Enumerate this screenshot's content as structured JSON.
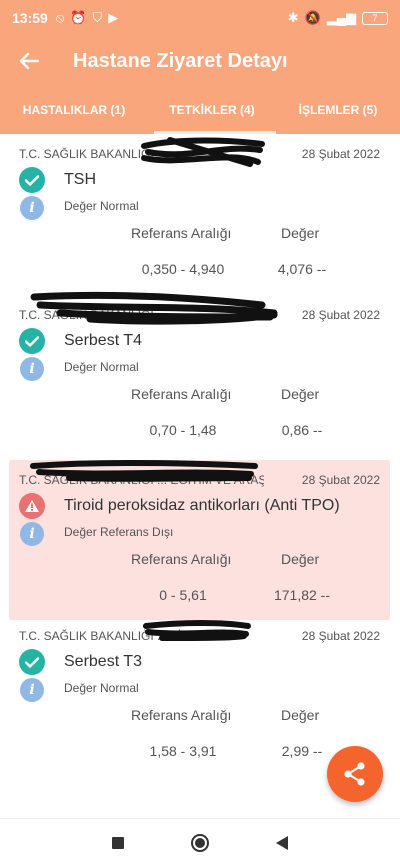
{
  "status_bar": {
    "time": "13:59",
    "battery": "7",
    "icons": [
      "no-disturb-icon",
      "alarm-icon",
      "vpn-shield-icon",
      "youtube-icon",
      "bluetooth-icon",
      "mute-icon",
      "signal-icon"
    ]
  },
  "app_bar": {
    "title": "Hastane Ziyaret Detayı",
    "back_icon": "arrow-left-icon"
  },
  "tabs": [
    {
      "label": "HASTALIKLAR (1)",
      "active": false
    },
    {
      "label": "TETKİKLER (4)",
      "active": true
    },
    {
      "label": "İŞLEMLER (5)",
      "active": false
    }
  ],
  "results": [
    {
      "hospital": "T.C. SAĞLIK BAKANLIĞI",
      "date": "28 Şubat 2022",
      "test": "TSH",
      "status": "ok",
      "note": "Değer Normal",
      "ref_label": "Referans Aralığı",
      "value_label": "Değer",
      "ref_range": "0,350 - 4,940",
      "value": "4,076 --"
    },
    {
      "hospital": "T.C. SAĞLIK BAKANLIĞI",
      "date": "28 Şubat 2022",
      "test": "Serbest T4",
      "status": "ok",
      "note": "Değer Normal",
      "ref_label": "Referans Aralığı",
      "value_label": "Değer",
      "ref_range": "0,70 - 1,48",
      "value": "0,86 --"
    },
    {
      "hospital": "T.C. SAĞLIK BAKANLIĞI ... EĞİTİM VE ARAŞTIRMA HASTANESİ DEVLET HASTANESİ ... FİZ",
      "date": "28 Şubat 2022",
      "test": "Tiroid peroksidaz antikorları (Anti TPO)",
      "status": "warn",
      "note": "Değer Referans Dışı",
      "ref_label": "Referans Aralığı",
      "value_label": "Değer",
      "ref_range": "0 - 5,61",
      "value": "171,82 --"
    },
    {
      "hospital": "T.C. SAĞLIK BAKANLIĞI ... FİZ",
      "date": "28 Şubat 2022",
      "test": "Serbest T3",
      "status": "ok",
      "note": "Değer Normal",
      "ref_label": "Referans Aralığı",
      "value_label": "Değer",
      "ref_range": "1,58 - 3,91",
      "value": "2,99 --"
    }
  ],
  "fab": {
    "icon": "share-icon"
  },
  "nav_bar": {
    "icons": [
      "recent-apps-icon",
      "home-icon",
      "back-icon"
    ]
  },
  "colors": {
    "primary": "#f9a67d",
    "accent": "#f4642c",
    "ok": "#26b3a5",
    "warn": "#e87171",
    "info": "#8fb8e4",
    "alert_bg": "#fde1df"
  }
}
